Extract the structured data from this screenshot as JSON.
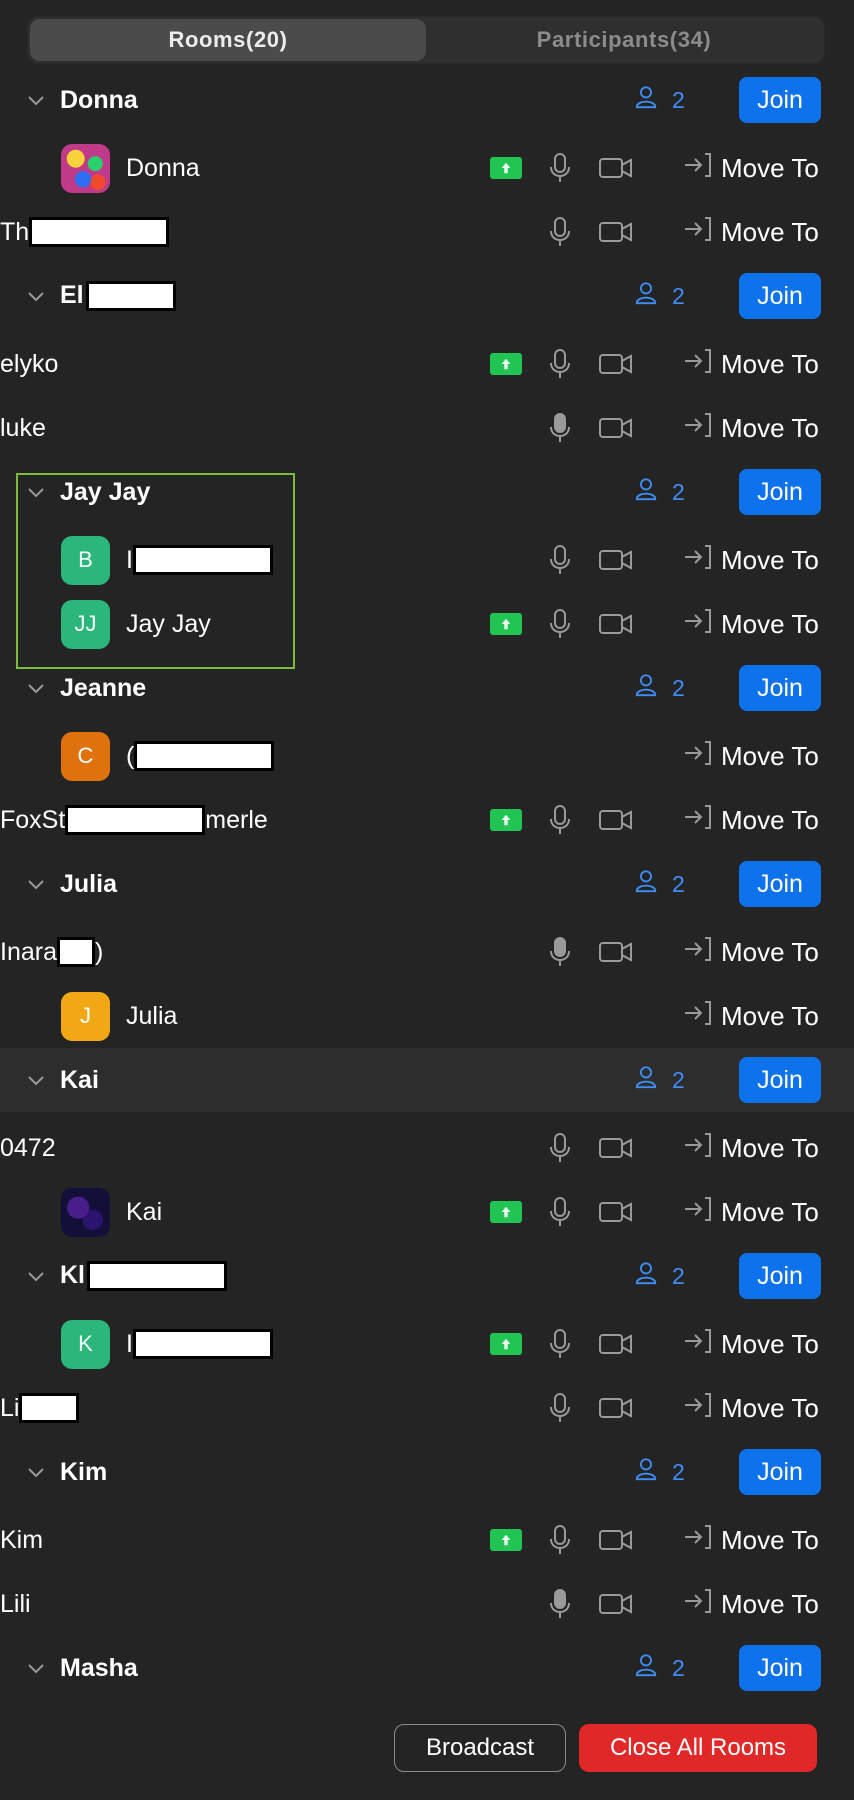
{
  "tabs": [
    {
      "label": "Rooms(20)",
      "active": true
    },
    {
      "label": "Participants(34)",
      "active": false
    }
  ],
  "labels": {
    "join": "Join",
    "move_to": "Move To"
  },
  "colors": {
    "accent": "#0e72ed",
    "count": "#3e8ef7",
    "share": "#23c552",
    "danger": "#e02828",
    "selection": "#7cbb3c"
  },
  "rows": [
    {
      "type": "room",
      "name": "Donna",
      "count": "2"
    },
    {
      "type": "participant",
      "name": "Donna",
      "avatar": {
        "kind": "image",
        "color": "#c03a8a"
      },
      "share": true,
      "mic": "off",
      "cam": true
    },
    {
      "type": "participant",
      "name": "Th",
      "indent": false,
      "redact": 140,
      "share": false,
      "mic": "off",
      "cam": true
    },
    {
      "type": "room",
      "name": "El",
      "redact": 90,
      "count": "2"
    },
    {
      "type": "participant",
      "name": "elyko",
      "indent": false,
      "share": true,
      "mic": "off",
      "cam": true
    },
    {
      "type": "participant",
      "name": "luke",
      "indent": false,
      "share": false,
      "mic": "on",
      "cam": true
    },
    {
      "type": "room",
      "name": "Jay Jay",
      "count": "2"
    },
    {
      "type": "participant",
      "name": "I",
      "avatar": {
        "initials": "B",
        "color": "#2bb67b"
      },
      "redact": 140,
      "share": false,
      "mic": "off",
      "cam": true
    },
    {
      "type": "participant",
      "name": "Jay Jay",
      "avatar": {
        "initials": "JJ",
        "color": "#2bb67b"
      },
      "share": true,
      "mic": "off",
      "cam": true
    },
    {
      "type": "room",
      "name": "Jeanne",
      "count": "2"
    },
    {
      "type": "participant",
      "name": "(",
      "avatar": {
        "initials": "C",
        "color": "#e0720e"
      },
      "redact": 140,
      "share": false,
      "mic": "none",
      "cam": false
    },
    {
      "type": "participant",
      "name": "FoxSt",
      "suffix": "merle",
      "indent": false,
      "redact": 140,
      "share": true,
      "mic": "off",
      "cam": true
    },
    {
      "type": "room",
      "name": "Julia",
      "count": "2"
    },
    {
      "type": "participant",
      "name": "Inara",
      "suffix": ")",
      "indent": false,
      "redact": 38,
      "share": false,
      "mic": "on",
      "cam": true
    },
    {
      "type": "participant",
      "name": "Julia",
      "avatar": {
        "initials": "J",
        "color": "#f2a814"
      },
      "share": false,
      "mic": "none",
      "cam": false
    },
    {
      "type": "room",
      "name": "Kai",
      "count": "2",
      "highlight": true
    },
    {
      "type": "participant",
      "name": "0472",
      "indent": false,
      "share": false,
      "mic": "off",
      "cam": true
    },
    {
      "type": "participant",
      "name": "Kai",
      "avatar": {
        "kind": "image",
        "color": "#1c1a4a"
      },
      "share": true,
      "mic": "off",
      "cam": true
    },
    {
      "type": "room",
      "name": "Kl",
      "redact": 140,
      "count": "2"
    },
    {
      "type": "participant",
      "name": "I",
      "avatar": {
        "initials": "K",
        "color": "#2bb67b"
      },
      "redact": 140,
      "share": true,
      "mic": "off",
      "cam": true
    },
    {
      "type": "participant",
      "name": "Li",
      "indent": false,
      "redact": 60,
      "share": false,
      "mic": "off",
      "cam": true
    },
    {
      "type": "room",
      "name": "Kim",
      "count": "2"
    },
    {
      "type": "participant",
      "name": "Kim",
      "indent": false,
      "share": true,
      "mic": "off",
      "cam": true
    },
    {
      "type": "participant",
      "name": "Lili",
      "indent": false,
      "share": false,
      "mic": "on",
      "cam": true
    },
    {
      "type": "room",
      "name": "Masha",
      "count": "2"
    }
  ],
  "footer": {
    "broadcast": "Broadcast",
    "close_all": "Close All Rooms"
  }
}
